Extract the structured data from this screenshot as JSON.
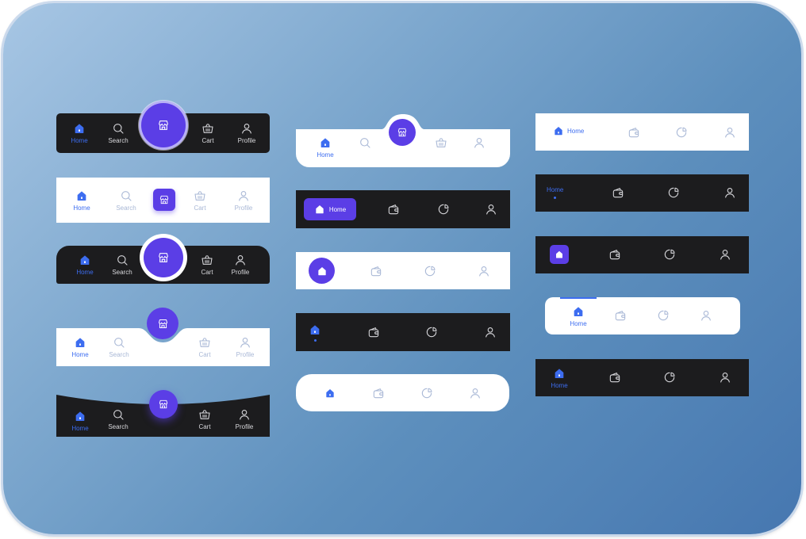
{
  "labels": {
    "home": "Home",
    "search": "Search",
    "cart": "Cart",
    "profile": "Profile"
  },
  "icons": {
    "home": "home-icon",
    "search": "search-icon",
    "store": "store-icon",
    "cart": "cart-basket-icon",
    "wallet": "wallet-icon",
    "chart": "pie-chart-icon",
    "profile": "profile-icon"
  },
  "colors": {
    "accent": "#3d6df0",
    "fab": "#5b3ee6",
    "dark_bar": "#1c1c1e",
    "light_bar": "#ffffff",
    "inactive_light": "#a9b8d6",
    "inactive_dark": "#d8d8dc"
  }
}
